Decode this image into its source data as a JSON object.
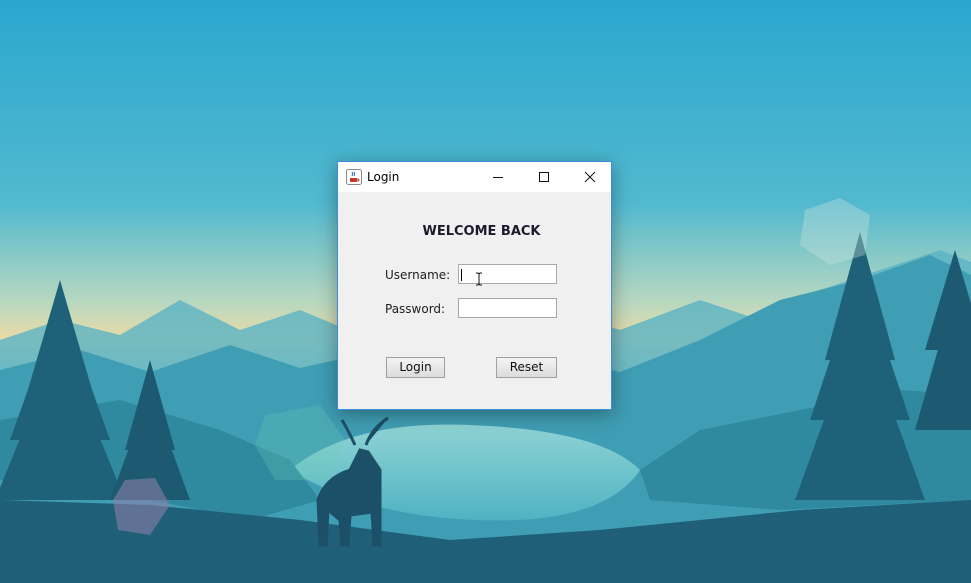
{
  "window": {
    "title": "Login",
    "accent_color": "#3c8ed6"
  },
  "form": {
    "heading": "WELCOME BACK",
    "username_label": "Username:",
    "username_value": "",
    "password_label": "Password:",
    "password_value": ""
  },
  "buttons": {
    "login_label": "Login",
    "reset_label": "Reset"
  },
  "icons": {
    "app": "java-cup-icon",
    "minimize": "minimize-icon",
    "maximize": "maximize-icon",
    "close": "close-icon"
  }
}
